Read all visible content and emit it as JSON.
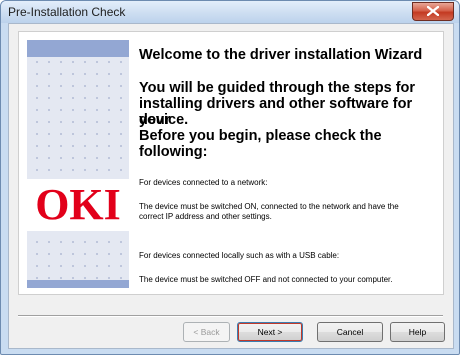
{
  "window": {
    "title": "Pre-Installation Check"
  },
  "logo": {
    "text": "OKI",
    "color": "#e2001a"
  },
  "content": {
    "heading1": "Welcome to the driver installation Wizard",
    "heading2_lines": [
      "You will be guided through the steps for",
      "installing drivers and other software for your",
      "device.",
      "Before you begin, please check the",
      "following:"
    ],
    "network_title": "For devices connected to a network:",
    "network_desc_lines": [
      "The device must be switched ON, connected to the network and have the",
      "correct IP address and other settings."
    ],
    "usb_title": "For devices connected locally such as with a USB cable:",
    "usb_desc": "The device must be switched OFF and not connected to your computer."
  },
  "buttons": {
    "back": "< Back",
    "next": "Next >",
    "cancel": "Cancel",
    "help": "Help"
  },
  "colors": {
    "side_band": "#93a7d3",
    "default_button_highlight": "#c0392b"
  }
}
